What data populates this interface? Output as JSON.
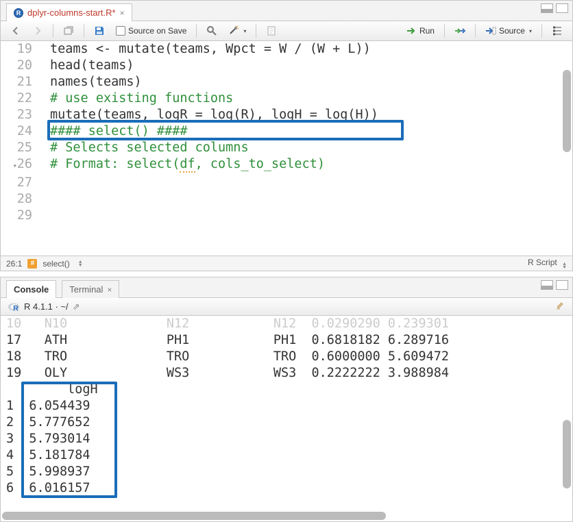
{
  "editor": {
    "tab": {
      "filename": "dplyr-columns-start.R*"
    },
    "toolbar": {
      "source_on_save": "Source on Save",
      "run": "Run",
      "source": "Source"
    },
    "gutter": [
      "19",
      "20",
      "21",
      "22",
      "23",
      "24",
      "25",
      "26",
      "27",
      "28",
      "29"
    ],
    "code": {
      "l19": "teams <- mutate(teams, Wpct = W / (W + L))",
      "l20": "head(teams)",
      "l21": "names(teams)",
      "l22": "",
      "l23": "# use existing functions",
      "l24": "mutate(teams, logR = log(R), logH = log(H))",
      "l25": "",
      "l26": "#### select() ####",
      "l27": "# Selects selected columns",
      "l28_pre": "# Format: select(",
      "l28_df": "df",
      "l28_post": ", cols_to_select)",
      "l29": ""
    },
    "status": {
      "pos": "26:1",
      "scope": "select()",
      "lang": "R Script"
    }
  },
  "console": {
    "tabs": {
      "console": "Console",
      "terminal": "Terminal"
    },
    "session": "R 4.1.1 · ~/",
    "rows_top": [
      {
        "n": "10",
        "c1": "N10",
        "c2": "N12",
        "c3": "N12",
        "v1": "0.0290290",
        "v2": "0.239301"
      },
      {
        "n": "17",
        "c1": "ATH",
        "c2": "PH1",
        "c3": "PH1",
        "v1": "0.6818182",
        "v2": "6.289716"
      },
      {
        "n": "18",
        "c1": "TRO",
        "c2": "TRO",
        "c3": "TRO",
        "v1": "0.6000000",
        "v2": "5.609472"
      },
      {
        "n": "19",
        "c1": "OLY",
        "c2": "WS3",
        "c3": "WS3",
        "v1": "0.2222222",
        "v2": "3.988984"
      }
    ],
    "logH_header": "logH",
    "rows_logH": [
      {
        "n": "1",
        "v": "6.054439"
      },
      {
        "n": "2",
        "v": "5.777652"
      },
      {
        "n": "3",
        "v": "5.793014"
      },
      {
        "n": "4",
        "v": "5.181784"
      },
      {
        "n": "5",
        "v": "5.998937"
      },
      {
        "n": "6",
        "v": "6.016157"
      }
    ]
  },
  "colors": {
    "highlight": "#1a6db8"
  }
}
